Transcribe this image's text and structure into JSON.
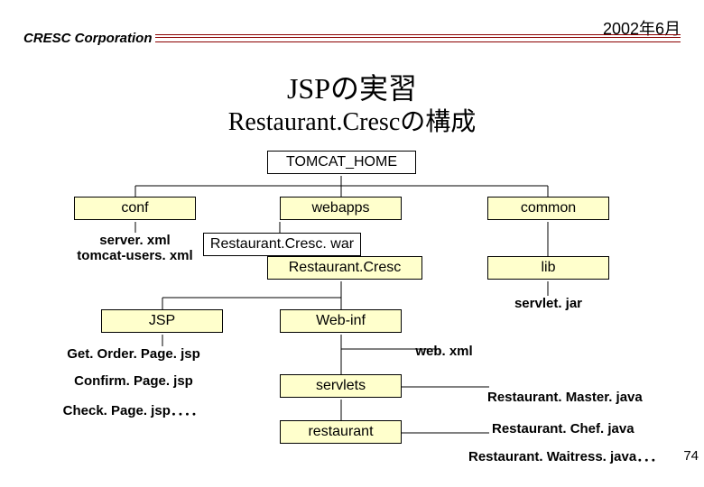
{
  "header": {
    "company": "CRESC Corporation",
    "date": "2002年6月"
  },
  "title": {
    "line1": "JSPの実習",
    "line2": "Restaurant.Crescの構成"
  },
  "nodes": {
    "tomcat_home": "TOMCAT_HOME",
    "conf": "conf",
    "webapps": "webapps",
    "common": "common",
    "war": "Restaurant.Cresc. war",
    "restaurant_cresc": "Restaurant.Cresc",
    "lib": "lib",
    "jsp": "JSP",
    "web_inf": "Web-inf",
    "servlets": "servlets",
    "restaurant": "restaurant"
  },
  "files": {
    "server_xml": "server. xml",
    "tomcat_users_xml": "tomcat-users. xml",
    "servlet_jar": "servlet. jar",
    "web_xml": "web. xml",
    "get_order": "Get. Order. Page. jsp",
    "confirm": "Confirm. Page. jsp",
    "check": "Check. Page. jsp．．．．",
    "master": "Restaurant. Master. java",
    "chef": "Restaurant. Chef. java",
    "waitress": "Restaurant. Waitress. java．．．"
  },
  "page_number": "74"
}
